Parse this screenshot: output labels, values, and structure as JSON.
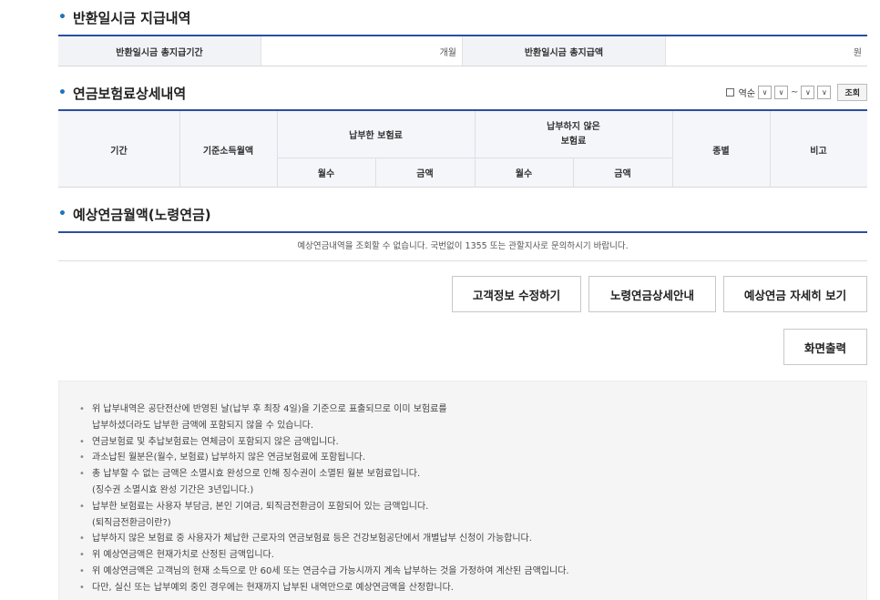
{
  "refund": {
    "title": "반환일시금 지급내역",
    "period_label": "반환일시금 총지급기간",
    "period_unit": "개월",
    "amount_label": "반환일시금 총지급액",
    "amount_unit": "원"
  },
  "detail": {
    "title": "연금보험료상세내역",
    "reverse_label": "역순",
    "search_button": "조회",
    "headers": {
      "period": "기간",
      "base_income": "기준소득월액",
      "paid": "납부한 보험료",
      "unpaid": "납부하지 않은\n보험료",
      "months": "월수",
      "amount": "금액",
      "type": "종별",
      "remarks": "비고"
    }
  },
  "expected": {
    "title": "예상연금월액(노령연금)",
    "message": "예상연금내역을 조회할 수 없습니다. 국번없이 1355 또는 관할지사로 문의하시기 바랍니다."
  },
  "buttons": {
    "edit_customer": "고객정보 수정하기",
    "old_age_guide": "노령연금상세안내",
    "expected_detail": "예상연금 자세히 보기",
    "print_screen": "화면출력"
  },
  "icons": {
    "select_arrow": "chevron-down-icon",
    "bullet": "bullet-icon"
  },
  "colors": {
    "accent": "#2b4f9e",
    "dot": "#1e73be"
  },
  "notes": [
    "위 납부내역은 공단전산에 반영된 날(납부 후 최장 4일)을 기준으로 표출되므로 이미 보험료를",
    "납부하셨더라도 납부한 금액에 포함되지 않을 수 있습니다.",
    "연금보험료 및 추납보험료는 연체금이 포함되지 않은 금액입니다.",
    "과소납된 월분은(월수, 보험료) 납부하지 않은 연금보험료에 포함됩니다.",
    "총 납부할 수 없는 금액은 소멸시효 완성으로 인해 징수권이 소멸된 월분 보험료입니다.",
    "(징수권 소멸시효 완성 기간은 3년입니다.)",
    "납부한 보험료는 사용자 부담금, 본인 기여금, 퇴직금전환금이 포함되어 있는 금액입니다.",
    "(퇴직금전환금이란?)",
    "납부하지 않은 보험료 중 사용자가 체납한 근로자의 연금보험료 등은 건강보험공단에서 개별납부 신청이 가능합니다.",
    "위 예상연금액은 현재가치로 산정된 금액입니다.",
    "위 예상연금액은 고객님의 현재 소득으로 만 60세 또는 연금수급 가능시까지 계속 납부하는 것을 가정하여 계산된 금액입니다.",
    "다만, 실신 또는 납부예외 중인 경우에는 현재까지 납부된 내역만으로 예상연금액을 산정합니다."
  ]
}
